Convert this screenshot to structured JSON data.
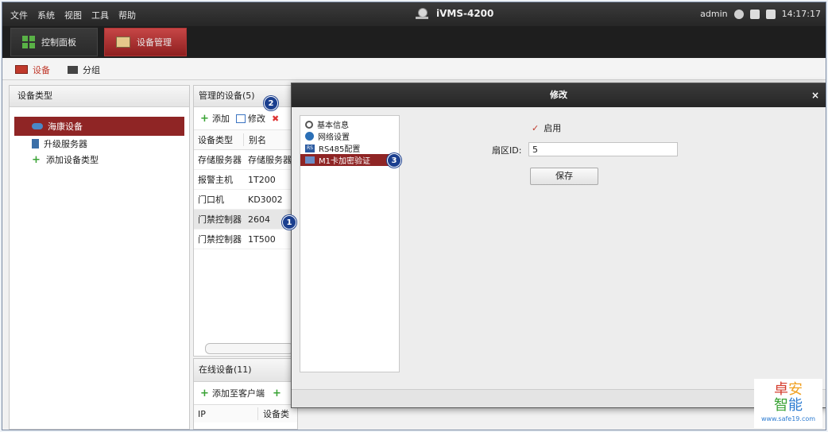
{
  "menu": [
    "文件",
    "系统",
    "视图",
    "工具",
    "帮助"
  ],
  "app_title": "iVMS-4200",
  "user": "admin",
  "clock": "14:17:17",
  "modules": [
    {
      "label": "控制面板"
    },
    {
      "label": "设备管理"
    }
  ],
  "subtabs": [
    {
      "label": "设备"
    },
    {
      "label": "分组"
    }
  ],
  "left_panel": {
    "title": "设备类型",
    "items": [
      {
        "label": "海康设备"
      },
      {
        "label": "升级服务器"
      },
      {
        "label": "添加设备类型"
      }
    ]
  },
  "managed": {
    "title": "管理的设备(5)",
    "add": "添加",
    "modify": "修改",
    "columns": [
      "设备类型",
      "别名"
    ],
    "rows": [
      {
        "type": "存储服务器",
        "alias": "存储服务器"
      },
      {
        "type": "报警主机",
        "alias": "1T200"
      },
      {
        "type": "门口机",
        "alias": "KD3002"
      },
      {
        "type": "门禁控制器",
        "alias": "2604"
      },
      {
        "type": "门禁控制器",
        "alias": "1T500"
      }
    ]
  },
  "online": {
    "title": "在线设备(11)",
    "add_client": "添加至客户端",
    "columns": [
      "IP",
      "设备类"
    ]
  },
  "badges": [
    "1",
    "2",
    "3"
  ],
  "modal": {
    "title": "修改",
    "close": "×",
    "nav": [
      {
        "label": "基本信息"
      },
      {
        "label": "网络设置"
      },
      {
        "label": "RS485配置"
      },
      {
        "label": "M1卡加密验证"
      }
    ],
    "enable_label": "启用",
    "sector_label": "扇区ID:",
    "sector_value": "5",
    "save": "保存"
  },
  "watermark": {
    "chars": [
      "卓",
      "安",
      "智",
      "能"
    ],
    "url": "www.safe19.com"
  }
}
